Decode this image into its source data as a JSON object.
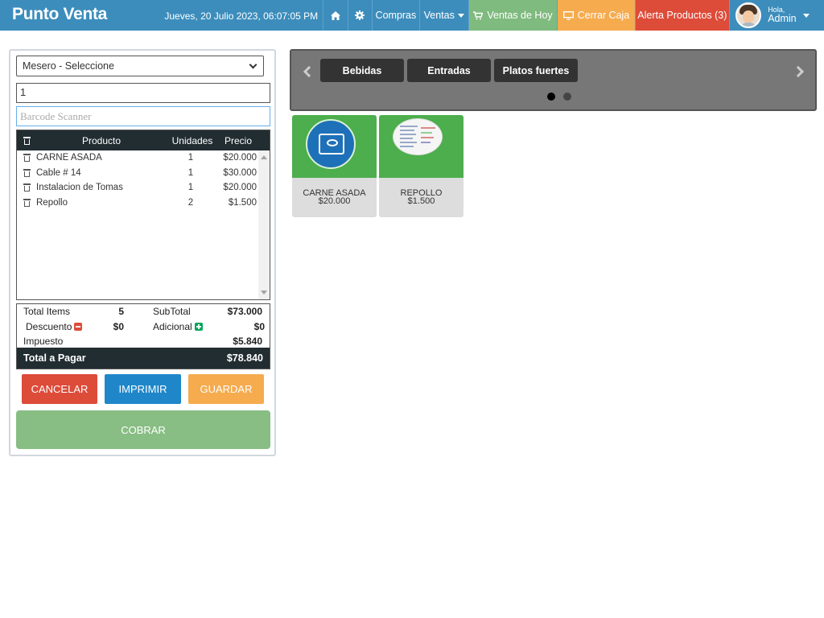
{
  "header": {
    "brand": "Punto Venta",
    "datetime": "Jueves, 20 Julio 2023, 06:07:05 PM",
    "home_icon": "home-icon",
    "settings_icon": "gear-icon",
    "compras": "Compras",
    "ventas": "Ventas",
    "ventas_hoy": "Ventas de Hoy",
    "cerrar_caja": "Cerrar Caja",
    "alerta_productos": "Alerta Productos (3)",
    "user_greeting": "Hola,",
    "user_name": "Admin",
    "colors": {
      "bar": "#3c8dbc",
      "green": "#7fba7e",
      "orange": "#f5ab4e",
      "red": "#dd4b39"
    }
  },
  "order": {
    "mesero_select": "Mesero - Seleccione",
    "quantity": "1",
    "barcode_placeholder": "Barcode Scanner",
    "columns": {
      "producto": "Producto",
      "unidades": "Unidades",
      "precio": "Precio"
    },
    "items": [
      {
        "producto": "CARNE ASADA",
        "unidades": "1",
        "precio": "$20.000"
      },
      {
        "producto": "Cable # 14",
        "unidades": "1",
        "precio": "$30.000"
      },
      {
        "producto": "Instalacion de Tomas",
        "unidades": "1",
        "precio": "$20.000"
      },
      {
        "producto": "Repollo",
        "unidades": "2",
        "precio": "$1.500"
      }
    ]
  },
  "totals": {
    "total_items_label": "Total Items",
    "total_items": "5",
    "subtotal_label": "SubTotal",
    "subtotal": "$73.000",
    "descuento_label": "Descuento",
    "descuento": "$0",
    "adicional_label": "Adicional",
    "adicional": "$0",
    "impuesto_label": "Impuesto",
    "impuesto": "$5.840",
    "total_label": "Total a Pagar",
    "total": "$78.840"
  },
  "actions": {
    "cancelar": "CANCELAR",
    "imprimir": "IMPRIMIR",
    "guardar": "GUARDAR",
    "cobrar": "COBRAR"
  },
  "categories": [
    "Bebidas",
    "Entradas",
    "Platos fuertes"
  ],
  "products": [
    {
      "name": "CARNE ASADA",
      "price": "$20.000"
    },
    {
      "name": "REPOLLO",
      "price": "$1.500"
    }
  ]
}
